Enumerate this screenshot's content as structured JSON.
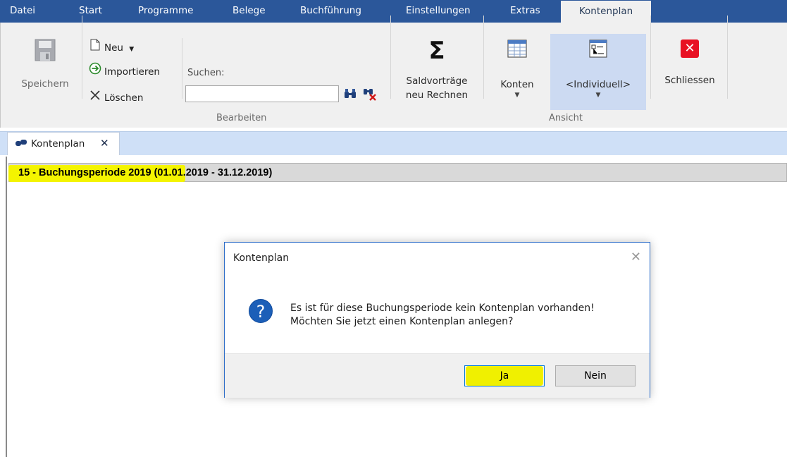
{
  "menubar": {
    "items": [
      "Datei",
      "Start",
      "Programme",
      "Belege",
      "Buchführung",
      "Einstellungen",
      "Extras",
      "Kontenplan"
    ],
    "active": "Kontenplan",
    "bg_color": "#2b579a"
  },
  "ribbon": {
    "save_label": "Speichern",
    "new_label": "Neu",
    "import_label": "Importieren",
    "delete_label": "Löschen",
    "search_label": "Suchen:",
    "search_value": "",
    "group_edit_label": "Bearbeiten",
    "balance_line1": "Saldvorträge",
    "balance_line2": "neu Rechnen",
    "accounts_label": "Konten",
    "custom_label": "<Individuell>",
    "group_view_label": "Ansicht",
    "close_label": "Schliessen"
  },
  "tabs": [
    {
      "label": "Kontenplan",
      "active": true
    }
  ],
  "period": {
    "title": "15 - Buchungsperiode 2019",
    "range": "(01.01.2019 - 31.12.2019)"
  },
  "dialog": {
    "title": "Kontenplan",
    "message_line1": "Es ist für diese Buchungsperiode kein Kontenplan vorhanden!",
    "message_line2": "Möchten Sie jetzt einen Kontenplan anlegen?",
    "yes_label": "Ja",
    "no_label": "Nein",
    "icon": "question-icon"
  },
  "colors": {
    "accent": "#2b579a",
    "highlight": "#f4f400",
    "close_red": "#e81123",
    "dialog_border": "#2b6cc8"
  }
}
